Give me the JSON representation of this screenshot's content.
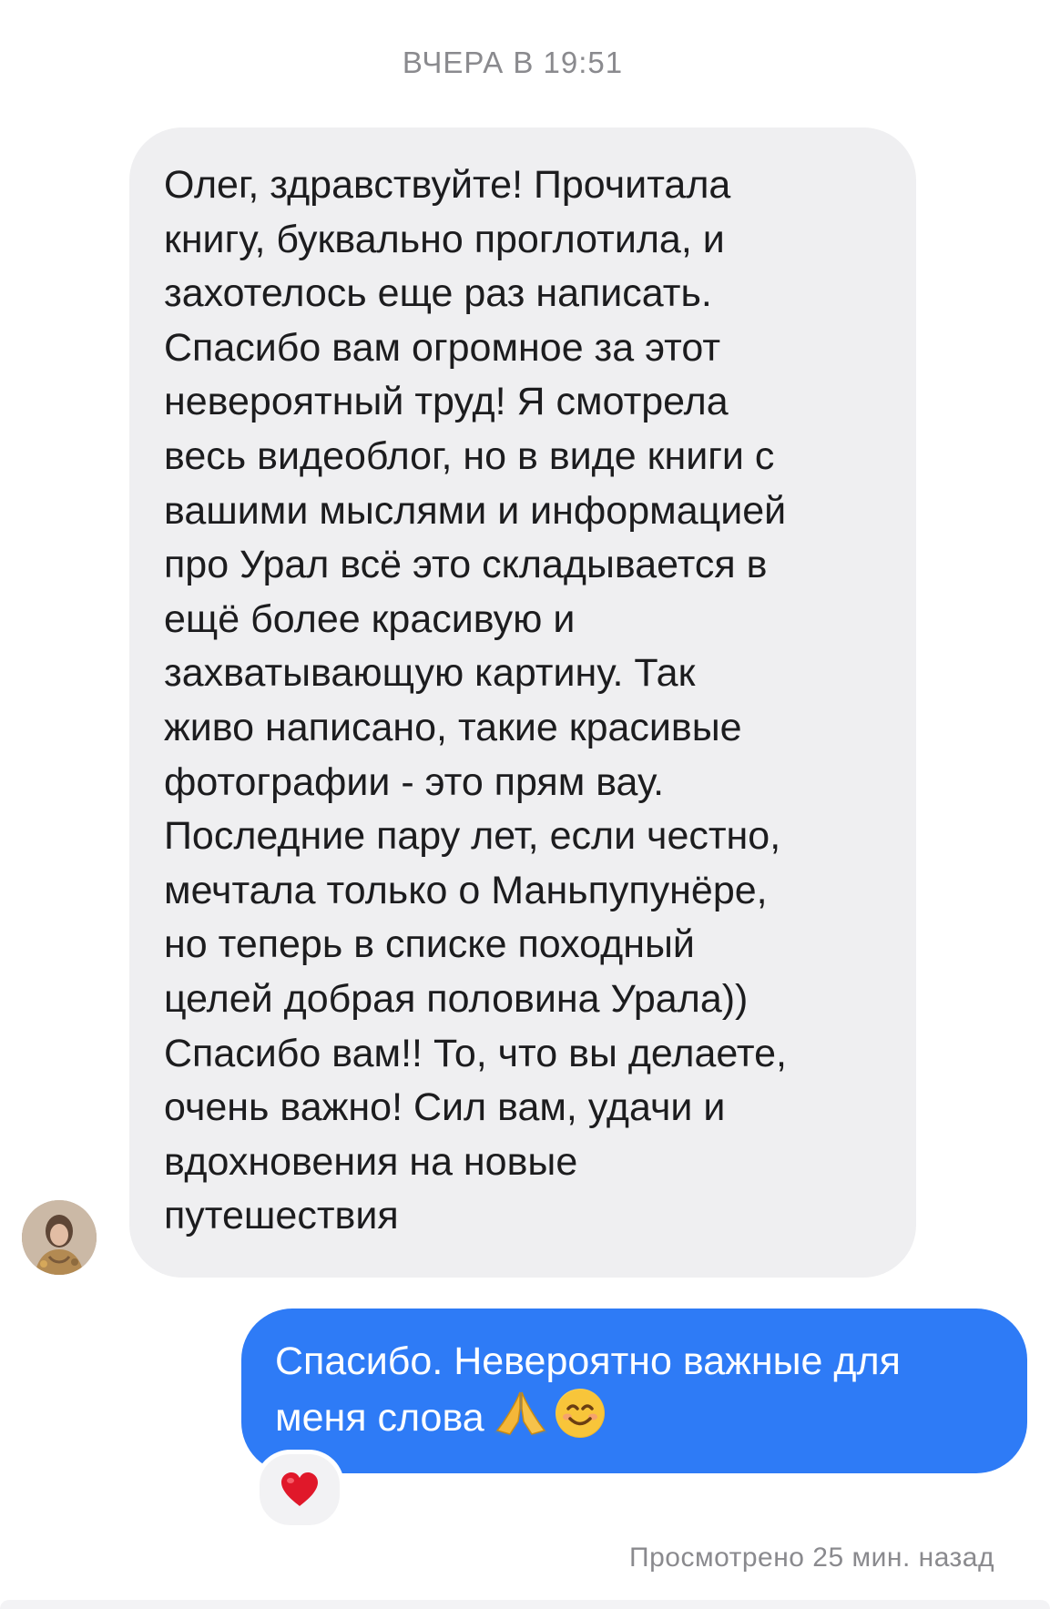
{
  "chat": {
    "timestamp": "ВЧЕРА В 19:51",
    "incoming": {
      "lines": [
        "Олег, здравствуйте! Прочитала",
        "книгу, буквально проглотила, и",
        "захотелось еще раз написать.",
        "Спасибо вам огромное за этот",
        "невероятный труд! Я смотрела",
        "весь видеоблог, но в виде книги с",
        "вашими мыслями и информацией",
        "про Урал всё это складывается в",
        "ещё более красивую и",
        "захватывающую картину. Так",
        "живо написано, такие красивые",
        "фотографии - это прям вау.",
        "Последние пару лет, если честно,",
        "мечтала только о Маньпупунёре,",
        "но теперь в списке походный",
        "целей добрая половина Урала))",
        "Спасибо вам!! То, что вы делаете,",
        "очень важно! Сил вам, удачи и",
        "вдохновения на новые",
        "путешествия"
      ]
    },
    "outgoing": {
      "line1": "Спасибо. Невероятно важные для",
      "line2": "меня слова",
      "emoji_1": "folded-hands-icon",
      "emoji_2": "smiling-face-icon"
    },
    "reaction": "heart-icon",
    "seen_status": "Просмотрено 25 мин. назад"
  },
  "colors": {
    "outgoing_bubble": "#2e7bf6",
    "incoming_bubble": "#efeff1",
    "meta_text": "#8a8a8e",
    "heart": "#e0182a"
  }
}
